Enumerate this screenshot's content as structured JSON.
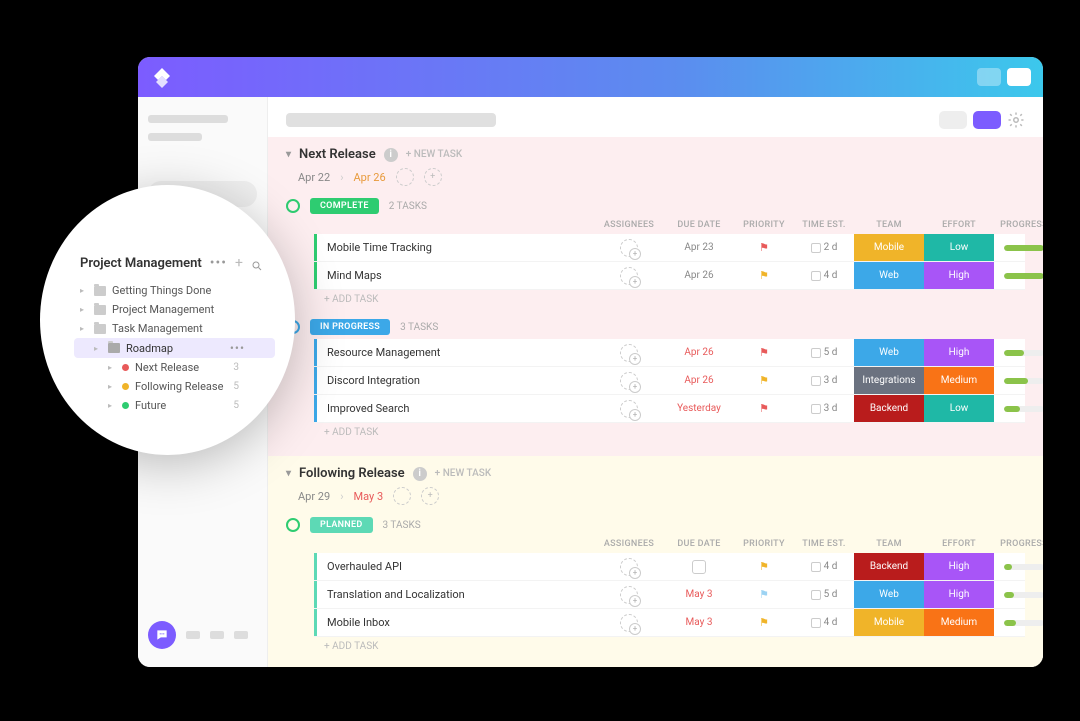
{
  "popover": {
    "title": "Project Management",
    "tree": [
      {
        "label": "Getting Things Done",
        "level": 1,
        "kind": "folder"
      },
      {
        "label": "Project Management",
        "level": 1,
        "kind": "folder"
      },
      {
        "label": "Task Management",
        "level": 1,
        "kind": "folder"
      },
      {
        "label": "Roadmap",
        "level": 2,
        "kind": "folder",
        "active": true
      },
      {
        "label": "Next Release",
        "level": 3,
        "kind": "dot",
        "color": "red",
        "count": "3"
      },
      {
        "label": "Following Release",
        "level": 3,
        "kind": "dot",
        "color": "yellow",
        "count": "5"
      },
      {
        "label": "Future",
        "level": 3,
        "kind": "dot",
        "color": "green",
        "count": "5"
      }
    ]
  },
  "columns": {
    "assignees": "ASSIGNEES",
    "due": "DUE DATE",
    "priority": "PRIORITY",
    "est": "TIME EST.",
    "team": "TEAM",
    "effort": "EFFORT",
    "progress": "PROGRESS"
  },
  "newTask": "+ NEW TASK",
  "addTask": "+ ADD TASK",
  "sections": [
    {
      "id": "next",
      "title": "Next Release",
      "dateFrom": "Apr 22",
      "dateTo": "Apr 26",
      "dateToClass": "",
      "groups": [
        {
          "status": "COMPLETE",
          "pillClass": "pill-complete",
          "checkClass": "",
          "rowClass": "complete",
          "countLabel": "2 TASKS",
          "showCols": true,
          "tasks": [
            {
              "name": "Mobile Time Tracking",
              "due": "Apr 23",
              "dueClass": "",
              "flag": "red",
              "est": "2 d",
              "team": "Mobile",
              "teamClass": "mobile",
              "effort": "Low",
              "effortClass": "low",
              "prog": 100
            },
            {
              "name": "Mind Maps",
              "due": "Apr 26",
              "dueClass": "",
              "flag": "yellow",
              "est": "4 d",
              "team": "Web",
              "teamClass": "web",
              "effort": "High",
              "effortClass": "high",
              "prog": 100
            }
          ]
        },
        {
          "status": "IN PROGRESS",
          "pillClass": "pill-progress",
          "checkClass": "blue",
          "rowClass": "progress",
          "countLabel": "3 TASKS",
          "showCols": false,
          "tasks": [
            {
              "name": "Resource Management",
              "due": "Apr 26",
              "dueClass": "red",
              "flag": "red",
              "est": "5 d",
              "team": "Web",
              "teamClass": "web",
              "effort": "High",
              "effortClass": "high",
              "prog": 50
            },
            {
              "name": "Discord Integration",
              "due": "Apr 26",
              "dueClass": "red",
              "flag": "yellow",
              "est": "3 d",
              "team": "Integrations",
              "teamClass": "integrations",
              "effort": "Medium",
              "effortClass": "medium",
              "prog": 60
            },
            {
              "name": "Improved Search",
              "due": "Yesterday",
              "dueClass": "red",
              "flag": "red",
              "est": "3 d",
              "team": "Backend",
              "teamClass": "backend",
              "effort": "Low",
              "effortClass": "low",
              "prog": 40
            }
          ]
        }
      ]
    },
    {
      "id": "following",
      "title": "Following Release",
      "dateFrom": "Apr 29",
      "dateTo": "May 3",
      "dateToClass": "red",
      "groups": [
        {
          "status": "PLANNED",
          "pillClass": "pill-planned",
          "checkClass": "",
          "rowClass": "planned",
          "countLabel": "3 TASKS",
          "showCols": true,
          "tasks": [
            {
              "name": "Overhauled API",
              "due": "",
              "dueClass": "",
              "flag": "yellow",
              "est": "4 d",
              "team": "Backend",
              "teamClass": "backend",
              "effort": "High",
              "effortClass": "high",
              "prog": 20,
              "calIcon": true
            },
            {
              "name": "Translation and Localization",
              "due": "May 3",
              "dueClass": "red",
              "flag": "blue",
              "est": "5 d",
              "team": "Web",
              "teamClass": "web",
              "effort": "High",
              "effortClass": "high",
              "prog": 25
            },
            {
              "name": "Mobile Inbox",
              "due": "May 3",
              "dueClass": "red",
              "flag": "yellow",
              "est": "4 d",
              "team": "Mobile",
              "teamClass": "mobile",
              "effort": "Medium",
              "effortClass": "medium",
              "prog": 30
            }
          ]
        }
      ]
    }
  ]
}
